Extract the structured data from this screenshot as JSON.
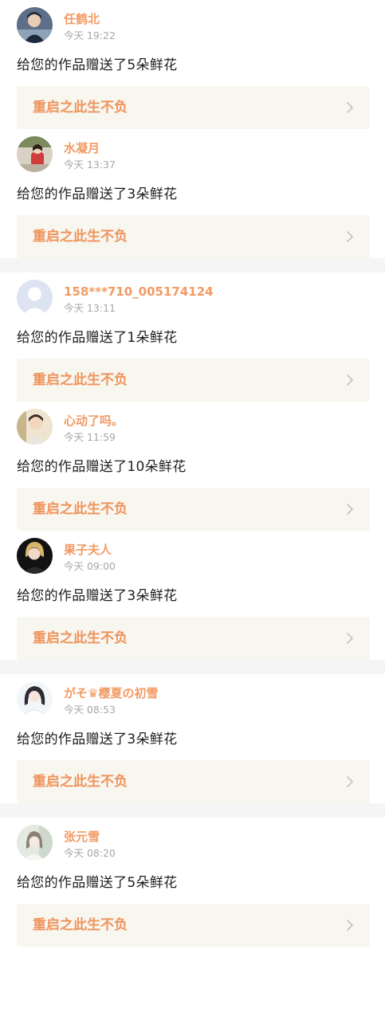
{
  "colors": {
    "accent": "#f29a63",
    "card_bg": "#f7f6ef",
    "gap": "#f5f5f5",
    "time": "#a6a6a6",
    "text": "#1e1e1e"
  },
  "notifications": [
    {
      "username": "任鹤北",
      "time": "今天 19:22",
      "message": "给您的作品赠送了5朵鲜花",
      "work_title": "重启之此生不负",
      "avatar": "photo-boy-dark",
      "gap_after": 0
    },
    {
      "username": "水凝月",
      "time": "今天 13:37",
      "message": "给您的作品赠送了3朵鲜花",
      "work_title": "重启之此生不负",
      "avatar": "photo-girl-red",
      "gap_after": 1
    },
    {
      "username": "158***710_005174124",
      "time": "今天 13:11",
      "message": "给您的作品赠送了1朵鲜花",
      "work_title": "重启之此生不负",
      "avatar": "default-avatar-icon",
      "gap_after": 0
    },
    {
      "username": "心动了吗。",
      "time": "今天 11:59",
      "message": "给您的作品赠送了10朵鲜花",
      "work_title": "重启之此生不负",
      "avatar": "photo-boy-light",
      "gap_after": 0
    },
    {
      "username": "果子夫人",
      "time": "今天 09:00",
      "message": "给您的作品赠送了3朵鲜花",
      "work_title": "重启之此生不负",
      "avatar": "photo-blonde-dark",
      "gap_after": 1
    },
    {
      "username": "がそ♛樱夏の初雪",
      "time": "今天 08:53",
      "message": "给您的作品赠送了3朵鲜花",
      "work_title": "重启之此生不负",
      "avatar": "photo-girl-white",
      "gap_after": 1
    },
    {
      "username": "张元雪",
      "time": "今天 08:20",
      "message": "给您的作品赠送了5朵鲜花",
      "work_title": "重启之此生不负",
      "avatar": "photo-girl-pale",
      "gap_after": 0
    }
  ]
}
